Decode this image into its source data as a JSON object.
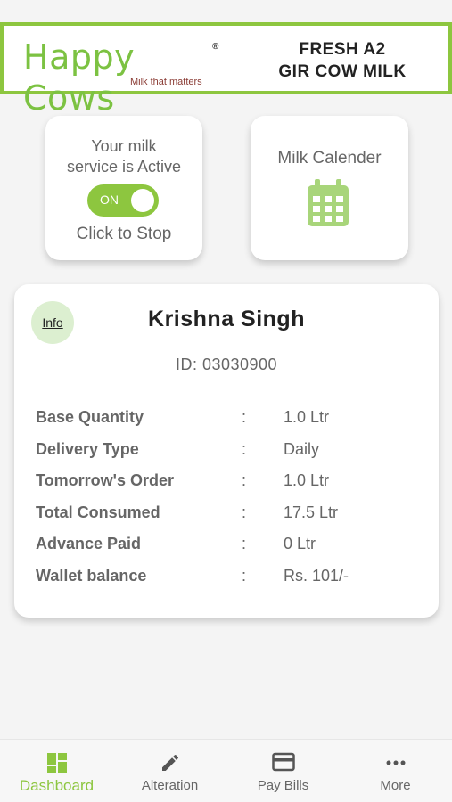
{
  "banner": {
    "brand_name": "Happy Cows",
    "tagline": "Milk that matters",
    "headline_line1": "FRESH A2",
    "headline_line2": "GIR COW MILK"
  },
  "service_card": {
    "line1": "Your milk",
    "line2": "service is Active",
    "toggle_label": "ON",
    "toggle_state": "on",
    "action_text": "Click to Stop"
  },
  "calendar_card": {
    "title": "Milk Calender",
    "icon": "calendar-icon"
  },
  "customer": {
    "info_label": "Info",
    "name": "Krishna Singh",
    "id_text": "ID: 03030900",
    "details": [
      {
        "label": "Base Quantity",
        "value": "1.0 Ltr"
      },
      {
        "label": "Delivery Type",
        "value": "Daily"
      },
      {
        "label": "Tomorrow's Order",
        "value": "1.0 Ltr"
      },
      {
        "label": "Total Consumed",
        "value": "17.5 Ltr"
      },
      {
        "label": "Advance Paid",
        "value": "0 Ltr"
      },
      {
        "label": "Wallet balance",
        "value": "Rs. 101/-"
      }
    ],
    "separator": ":"
  },
  "nav": {
    "items": [
      {
        "label": "Dashboard",
        "icon": "dashboard-icon",
        "active": true
      },
      {
        "label": "Alteration",
        "icon": "pencil-icon",
        "active": false
      },
      {
        "label": "Pay Bills",
        "icon": "credit-card-icon",
        "active": false
      },
      {
        "label": "More",
        "icon": "more-dots-icon",
        "active": false
      }
    ]
  },
  "colors": {
    "accent": "#8dc63f",
    "tagline": "#8a3b34",
    "text_muted": "#666666"
  }
}
